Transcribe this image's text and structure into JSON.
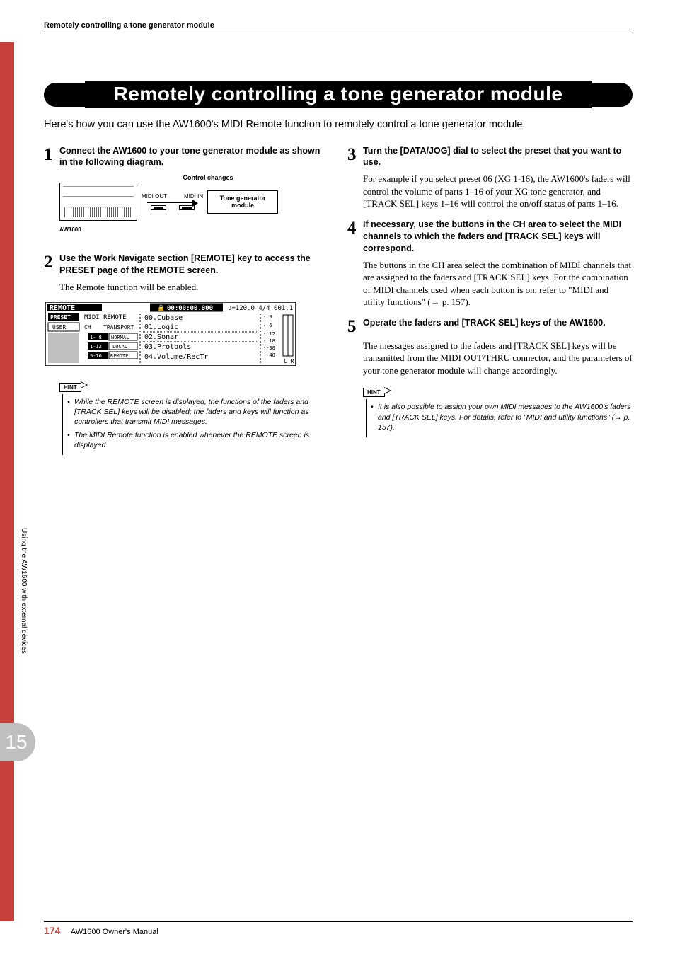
{
  "running_head": "Remotely controlling a tone generator module",
  "title": "Remotely controlling a tone generator module",
  "intro": "Here's how you can use the AW1600's MIDI Remote function to remotely control a tone generator module.",
  "left": {
    "step1": {
      "num": "1",
      "head": "Connect the AW1600 to your tone generator module as shown in the following diagram."
    },
    "diagram": {
      "cc_label": "Control changes",
      "midi_out": "MIDI OUT",
      "midi_in": "MIDI IN",
      "tone_box_l1": "Tone generator",
      "tone_box_l2": "module",
      "device_label": "AW1600"
    },
    "step2": {
      "num": "2",
      "head": "Use the Work Navigate section [REMOTE] key to access the PRESET page of the REMOTE screen.",
      "body": "The Remote function will be enabled."
    },
    "screenshot": {
      "title_bar": "REMOTE",
      "time": "00:00:00.000",
      "tempo": "♩=120.0 4/4 001.1",
      "preset": "PRESET",
      "user": "USER",
      "midi_remote": "MIDI REMOTE",
      "ch": "CH",
      "transport": "TRANSPORT",
      "btn1": "1- 8",
      "btn1b": "NORMAL",
      "btn2": "1-12",
      "btn2b": "LOCAL",
      "btn3": "9-16",
      "btn3b": "REMOTE",
      "list": [
        "00.Cubase",
        "01.Logic",
        "02.Sonar",
        "03.Protools",
        "04.Volume/RecTr"
      ],
      "right_marks": [
        "-  0",
        "-  6",
        "- 12",
        "- 18",
        "--30",
        "--48"
      ],
      "lr": "L R"
    },
    "hint": {
      "label": "HINT",
      "items": [
        "While the REMOTE screen is displayed, the functions of the faders and [TRACK SEL] keys will be disabled; the faders and keys will function as controllers that transmit MIDI messages.",
        "The MIDI Remote function is enabled whenever the REMOTE screen is displayed."
      ]
    }
  },
  "right": {
    "step3": {
      "num": "3",
      "head": "Turn the [DATA/JOG] dial to select the preset that you want to use.",
      "body": "For example if you select preset 06 (XG 1-16), the AW1600's faders will control the volume of parts 1–16 of your XG tone generator, and [TRACK SEL] keys 1–16 will control the on/off status of parts 1–16."
    },
    "step4": {
      "num": "4",
      "head": "If necessary, use the buttons in the CH area to select the MIDI channels to which the faders and [TRACK SEL] keys will correspond.",
      "body": "The buttons in the CH area select the combination of MIDI channels that are assigned to the faders and [TRACK SEL] keys. For the combination of MIDI channels used when each button is on, refer to \"MIDI and utility functions\" (→ p. 157)."
    },
    "step5": {
      "num": "5",
      "head": "Operate the faders and [TRACK SEL] keys of the AW1600.",
      "body": "The messages assigned to the faders and [TRACK SEL] keys will be transmitted from the MIDI OUT/THRU connector, and the parameters of your tone generator module will change accordingly."
    },
    "hint": {
      "label": "HINT",
      "items": [
        "It is also possible to assign your own MIDI messages to the AW1600's faders and [TRACK SEL] keys. For details, refer to \"MIDI and utility functions\" (→ p. 157)."
      ]
    }
  },
  "side": {
    "label": "Using the AW1600 with external devices",
    "chapter": "15"
  },
  "footer": {
    "page": "174",
    "manual": "AW1600  Owner's Manual"
  }
}
